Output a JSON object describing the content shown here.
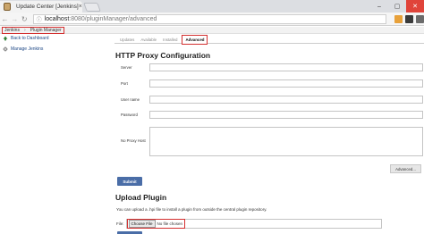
{
  "browser": {
    "tab_title": "Update Center [Jenkins]",
    "tab_close": "×",
    "window_controls": [
      "–",
      "▢",
      "✕"
    ],
    "back_icon": "back-arrow-icon",
    "forward_icon": "forward-arrow-icon",
    "url_host": "localhost",
    "url_path": ":8080/pluginManager/advanced"
  },
  "breadcrumb": {
    "items": [
      "Jenkins",
      "Plugin Manager"
    ],
    "separator": "›"
  },
  "sidebar": {
    "items": [
      {
        "label": "Back to Dashboard",
        "icon": "up-arrow-icon"
      },
      {
        "label": "Manage Jenkins",
        "icon": "gear-icon"
      }
    ]
  },
  "tabs": {
    "items": [
      "Updates",
      "Available",
      "Installed",
      "Advanced"
    ],
    "active": "Advanced"
  },
  "proxy": {
    "title": "HTTP Proxy Configuration",
    "fields": [
      {
        "label": "Server",
        "value": ""
      },
      {
        "label": "Port",
        "value": ""
      },
      {
        "label": "User name",
        "value": ""
      },
      {
        "label": "Password",
        "value": ""
      },
      {
        "label": "No Proxy Host",
        "value": ""
      }
    ],
    "advanced_label": "Advanced...",
    "submit_label": "Submit"
  },
  "upload": {
    "title": "Upload Plugin",
    "help": "You can upload a .hpi file to install a plugin from outside the central plugin repository.",
    "file_label": "File:",
    "choose_label": "Choose File",
    "file_status": "No file chosen"
  },
  "colors": {
    "accent_button": "#4a6da7",
    "highlight_red": "#d32f2f",
    "close_red": "#e0443a"
  }
}
